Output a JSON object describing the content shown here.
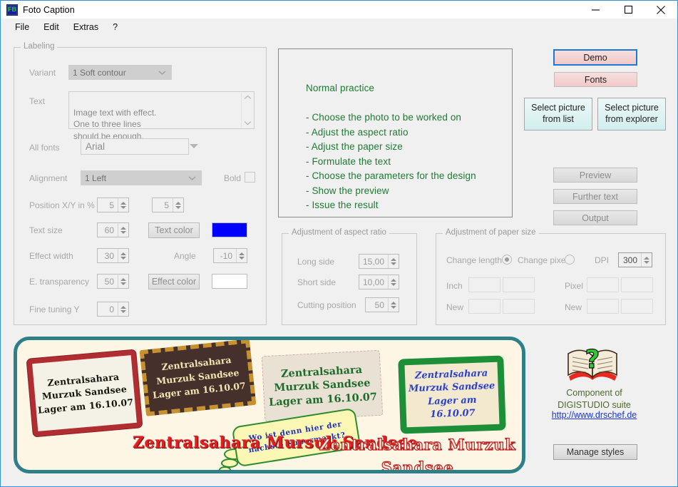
{
  "window": {
    "title": "Foto Caption",
    "icon": "app-icon-fb",
    "minimize": "minimize-icon",
    "maximize": "maximize-icon",
    "close": "close-icon"
  },
  "menu": [
    {
      "label": "File"
    },
    {
      "label": "Edit"
    },
    {
      "label": "Extras"
    },
    {
      "label": "?"
    }
  ],
  "labeling": {
    "title": "Labeling",
    "variant_label": "Variant",
    "variant_value": "1 Soft contour",
    "text_label": "Text",
    "text_value": "Image text with effect.\nOne to three lines\nshould be enough.",
    "allfonts_label": "All fonts",
    "allfonts_value": "Arial",
    "alignment_label": "Alignment",
    "alignment_value": "1 Left",
    "bold_label": "Bold",
    "bold_checked": false,
    "position_label": "Position X/Y in %",
    "position_x": "5",
    "position_y": "5",
    "textsize_label": "Text size",
    "textsize_value": "60",
    "textcolor_button": "Text color",
    "textcolor_swatch": "#0000ff",
    "effectwidth_label": "Effect width",
    "effectwidth_value": "30",
    "angle_label": "Angle",
    "angle_value": "-10",
    "etransparency_label": "E. transparency",
    "etransparency_value": "50",
    "effectcolor_button": "Effect color",
    "effectcolor_swatch": "#ffffff",
    "finetuning_label": "Fine tuning Y",
    "finetuning_value": "0"
  },
  "preview": {
    "text": "Normal practice\n\n- Choose the photo to be worked on\n- Adjust the aspect ratio\n- Adjust the paper size\n- Formulate the text\n- Choose the parameters for the design\n- Show the preview\n- Issue the result",
    "text_color": "#1f7a34"
  },
  "aspect": {
    "title": "Adjustment of aspect ratio",
    "long_label": "Long side",
    "long_value": "15,00",
    "short_label": "Short side",
    "short_value": "10,00",
    "cutting_label": "Cutting position",
    "cutting_value": "50"
  },
  "paper": {
    "title": "Adjustment of paper size",
    "change_length_label": "Change length",
    "change_length_selected": true,
    "change_pixel_label": "Change pixel",
    "change_pixel_selected": false,
    "dpi_label": "DPI",
    "dpi_value": "300",
    "inch_label": "Inch",
    "inch_new_label": "New",
    "pixel_label": "Pixel",
    "pixel_new_label": "New",
    "inch_w": "",
    "inch_h": "",
    "inch_new_w": "",
    "inch_new_h": "",
    "pixel_w": "",
    "pixel_h": "",
    "pixel_new_w": "",
    "pixel_new_h": ""
  },
  "actions": {
    "demo": "Demo",
    "fonts": "Fonts",
    "select_from_list": "Select picture\nfrom list",
    "select_from_explorer": "Select picture\nfrom explorer",
    "preview": "Preview",
    "further_text": "Further text",
    "output": "Output",
    "manage_styles": "Manage styles"
  },
  "banner": {
    "card1": "Zentralsahara\nMurzuk Sandsee\nLager am 16.10.07",
    "card2": "Zentralsahara\nMurzuk Sandsee\nLager am 16.10.07",
    "card3": "Zentralsahara\nMurzuk Sandsee\nLager am 16.10.07",
    "card4": "Zentralsahara\nMurzuk Sandsee\nLager am 16.10.07",
    "bubble": "Wo ist denn hier der\nnächste Supermarkt?",
    "big_red_left": "Zentralsahara\nMursuk Sandsee",
    "big_red_right": "Zentralsahara\nMurzuk Sandsee",
    "border_color": "#2e7f88",
    "background_color": "#fdf6e4"
  },
  "component": {
    "icon": "open-book-question-icon",
    "line1": "Component of",
    "line2": "DIGISTUDIO suite",
    "link": "http://www.drschef.de"
  }
}
